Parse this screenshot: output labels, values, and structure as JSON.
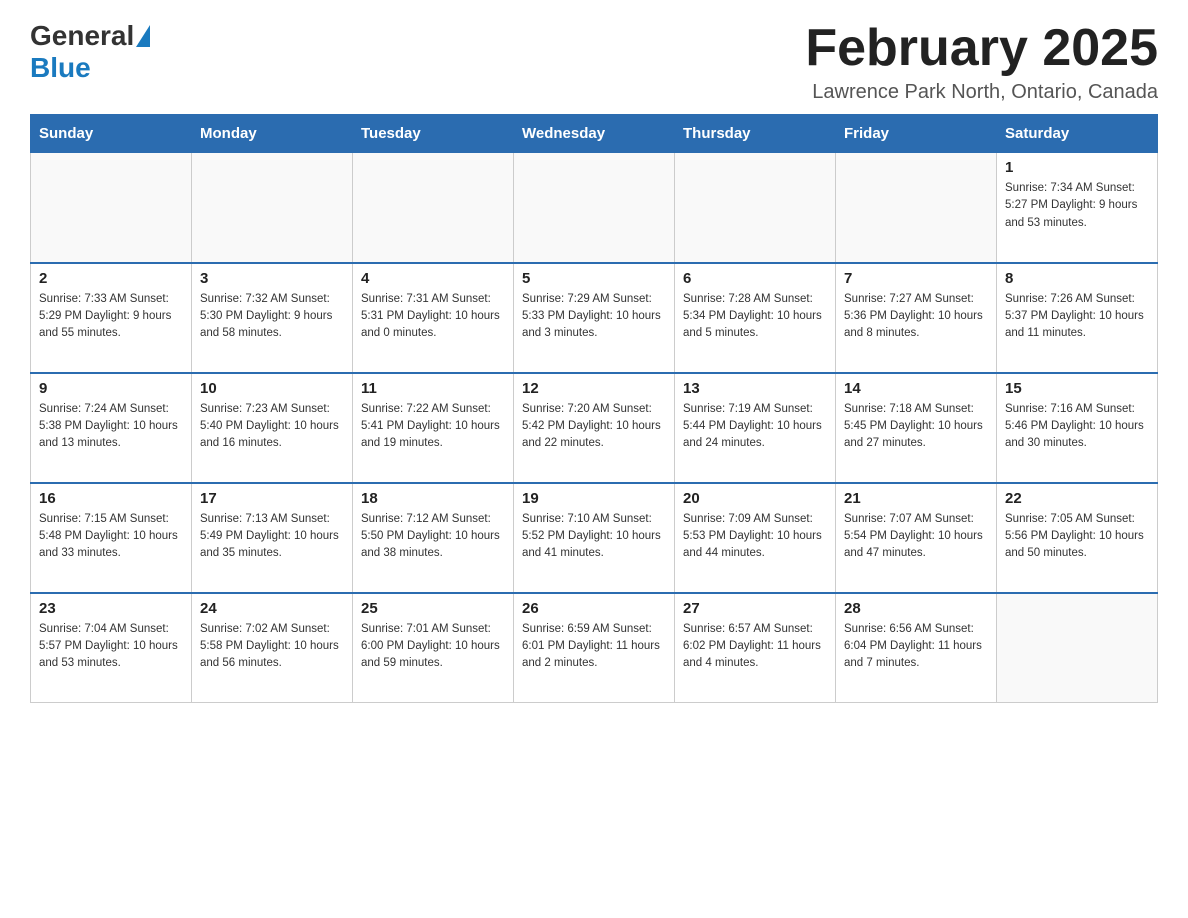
{
  "header": {
    "logo_general": "General",
    "logo_blue": "Blue",
    "month_title": "February 2025",
    "location": "Lawrence Park North, Ontario, Canada"
  },
  "weekdays": [
    "Sunday",
    "Monday",
    "Tuesday",
    "Wednesday",
    "Thursday",
    "Friday",
    "Saturday"
  ],
  "weeks": [
    [
      {
        "day": "",
        "info": ""
      },
      {
        "day": "",
        "info": ""
      },
      {
        "day": "",
        "info": ""
      },
      {
        "day": "",
        "info": ""
      },
      {
        "day": "",
        "info": ""
      },
      {
        "day": "",
        "info": ""
      },
      {
        "day": "1",
        "info": "Sunrise: 7:34 AM\nSunset: 5:27 PM\nDaylight: 9 hours and 53 minutes."
      }
    ],
    [
      {
        "day": "2",
        "info": "Sunrise: 7:33 AM\nSunset: 5:29 PM\nDaylight: 9 hours and 55 minutes."
      },
      {
        "day": "3",
        "info": "Sunrise: 7:32 AM\nSunset: 5:30 PM\nDaylight: 9 hours and 58 minutes."
      },
      {
        "day": "4",
        "info": "Sunrise: 7:31 AM\nSunset: 5:31 PM\nDaylight: 10 hours and 0 minutes."
      },
      {
        "day": "5",
        "info": "Sunrise: 7:29 AM\nSunset: 5:33 PM\nDaylight: 10 hours and 3 minutes."
      },
      {
        "day": "6",
        "info": "Sunrise: 7:28 AM\nSunset: 5:34 PM\nDaylight: 10 hours and 5 minutes."
      },
      {
        "day": "7",
        "info": "Sunrise: 7:27 AM\nSunset: 5:36 PM\nDaylight: 10 hours and 8 minutes."
      },
      {
        "day": "8",
        "info": "Sunrise: 7:26 AM\nSunset: 5:37 PM\nDaylight: 10 hours and 11 minutes."
      }
    ],
    [
      {
        "day": "9",
        "info": "Sunrise: 7:24 AM\nSunset: 5:38 PM\nDaylight: 10 hours and 13 minutes."
      },
      {
        "day": "10",
        "info": "Sunrise: 7:23 AM\nSunset: 5:40 PM\nDaylight: 10 hours and 16 minutes."
      },
      {
        "day": "11",
        "info": "Sunrise: 7:22 AM\nSunset: 5:41 PM\nDaylight: 10 hours and 19 minutes."
      },
      {
        "day": "12",
        "info": "Sunrise: 7:20 AM\nSunset: 5:42 PM\nDaylight: 10 hours and 22 minutes."
      },
      {
        "day": "13",
        "info": "Sunrise: 7:19 AM\nSunset: 5:44 PM\nDaylight: 10 hours and 24 minutes."
      },
      {
        "day": "14",
        "info": "Sunrise: 7:18 AM\nSunset: 5:45 PM\nDaylight: 10 hours and 27 minutes."
      },
      {
        "day": "15",
        "info": "Sunrise: 7:16 AM\nSunset: 5:46 PM\nDaylight: 10 hours and 30 minutes."
      }
    ],
    [
      {
        "day": "16",
        "info": "Sunrise: 7:15 AM\nSunset: 5:48 PM\nDaylight: 10 hours and 33 minutes."
      },
      {
        "day": "17",
        "info": "Sunrise: 7:13 AM\nSunset: 5:49 PM\nDaylight: 10 hours and 35 minutes."
      },
      {
        "day": "18",
        "info": "Sunrise: 7:12 AM\nSunset: 5:50 PM\nDaylight: 10 hours and 38 minutes."
      },
      {
        "day": "19",
        "info": "Sunrise: 7:10 AM\nSunset: 5:52 PM\nDaylight: 10 hours and 41 minutes."
      },
      {
        "day": "20",
        "info": "Sunrise: 7:09 AM\nSunset: 5:53 PM\nDaylight: 10 hours and 44 minutes."
      },
      {
        "day": "21",
        "info": "Sunrise: 7:07 AM\nSunset: 5:54 PM\nDaylight: 10 hours and 47 minutes."
      },
      {
        "day": "22",
        "info": "Sunrise: 7:05 AM\nSunset: 5:56 PM\nDaylight: 10 hours and 50 minutes."
      }
    ],
    [
      {
        "day": "23",
        "info": "Sunrise: 7:04 AM\nSunset: 5:57 PM\nDaylight: 10 hours and 53 minutes."
      },
      {
        "day": "24",
        "info": "Sunrise: 7:02 AM\nSunset: 5:58 PM\nDaylight: 10 hours and 56 minutes."
      },
      {
        "day": "25",
        "info": "Sunrise: 7:01 AM\nSunset: 6:00 PM\nDaylight: 10 hours and 59 minutes."
      },
      {
        "day": "26",
        "info": "Sunrise: 6:59 AM\nSunset: 6:01 PM\nDaylight: 11 hours and 2 minutes."
      },
      {
        "day": "27",
        "info": "Sunrise: 6:57 AM\nSunset: 6:02 PM\nDaylight: 11 hours and 4 minutes."
      },
      {
        "day": "28",
        "info": "Sunrise: 6:56 AM\nSunset: 6:04 PM\nDaylight: 11 hours and 7 minutes."
      },
      {
        "day": "",
        "info": ""
      }
    ]
  ]
}
